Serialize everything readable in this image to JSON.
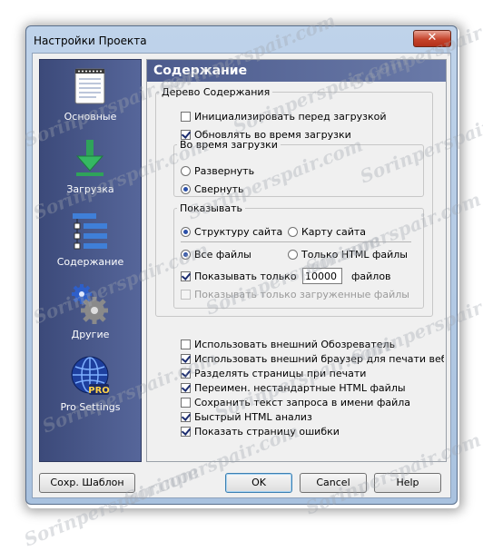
{
  "window": {
    "title": "Настройки Проекта",
    "close_glyph": "✕"
  },
  "sidebar": {
    "items": [
      {
        "label": "Основные",
        "icon": "notepad-icon"
      },
      {
        "label": "Загрузка",
        "icon": "download-arrow-icon"
      },
      {
        "label": "Содержание",
        "icon": "tree-structure-icon"
      },
      {
        "label": "Другие",
        "icon": "gears-icon"
      },
      {
        "label": "Pro Settings",
        "icon": "globe-pro-icon"
      }
    ]
  },
  "content": {
    "header": "Содержание",
    "tree_group": {
      "legend": "Дерево Содержания",
      "init_before_load": "Инициализировать перед загрузкой",
      "update_during_load": "Обновлять во время загрузки"
    },
    "during_load_group": {
      "legend": "Во время загрузки",
      "expand": "Развернуть",
      "collapse": "Свернуть"
    },
    "show_group": {
      "legend": "Показывать",
      "site_structure": "Структуру сайта",
      "site_map": "Карту сайта",
      "all_files": "Все файлы",
      "only_html": "Только HTML файлы",
      "show_only": "Показывать только",
      "show_only_value": "10000",
      "files_suffix": "файлов",
      "show_only_loaded": "Показывать только загруженные файлы"
    },
    "options": [
      {
        "label": "Использовать внешний Обозреватель",
        "checked": false
      },
      {
        "label": "Использовать внешний браузер для печати веб-",
        "checked": true
      },
      {
        "label": "Разделять страницы при печати",
        "checked": true
      },
      {
        "label": "Переимен. нестандартные HTML файлы",
        "checked": true
      },
      {
        "label": "Сохранить текст запроса в имени файла",
        "checked": false
      },
      {
        "label": "Быстрый HTML анализ",
        "checked": true
      },
      {
        "label": "Показать страницу ошибки",
        "checked": true
      }
    ]
  },
  "footer": {
    "save_template": "Сохр. Шаблон",
    "ok": "OK",
    "cancel": "Cancel",
    "help": "Help"
  },
  "watermark": {
    "text": "Sorinperspair.com"
  },
  "colors": {
    "sidebar": "#3c4a7a",
    "header": "#4c5b8d",
    "close": "#c5432b"
  }
}
